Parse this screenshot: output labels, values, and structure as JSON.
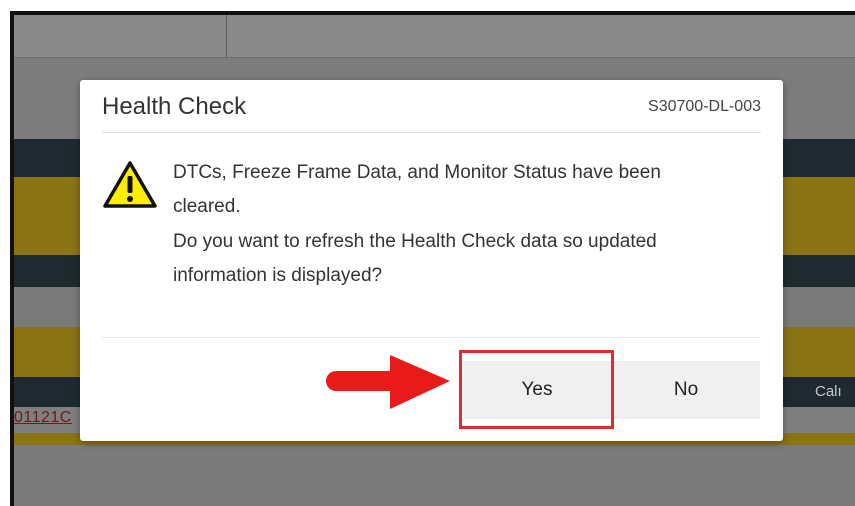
{
  "dialog": {
    "title": "Health Check",
    "code": "S30700-DL-003",
    "message_lines": [
      "DTCs, Freeze Frame Data, and Monitor Status have been",
      "cleared.",
      "Do you want to refresh the Health Check data so updated",
      "information is displayed?"
    ],
    "icon": "warning-icon",
    "buttons": {
      "yes": "Yes",
      "no": "No"
    }
  },
  "background": {
    "link_fragment": "01121C",
    "cell_fragment": "Calı"
  },
  "annotation": {
    "highlight_color": "#e22c2c",
    "arrow_color": "#e81a1a",
    "target": "yes-button"
  },
  "colors": {
    "dialog_bg": "#ffffff",
    "button_bg": "#f0f0f0",
    "warning_fill": "#ffee00"
  }
}
